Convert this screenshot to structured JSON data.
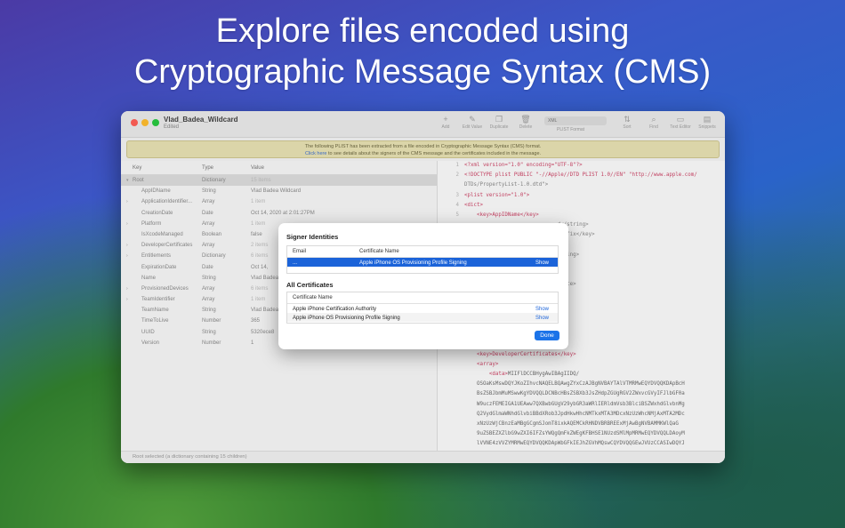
{
  "headline": {
    "line1": "Explore files encoded using",
    "line2": "Cryptographic Message Syntax (CMS)"
  },
  "window": {
    "title": "Vlad_Badea_Wildcard",
    "subtitle": "Edited",
    "format_value": "XML",
    "format_label": "PLIST Format",
    "toolbar": [
      {
        "label": "Add",
        "icon": "plus-icon"
      },
      {
        "label": "Edit Value",
        "icon": "pencil-icon"
      },
      {
        "label": "Duplicate",
        "icon": "duplicate-icon"
      },
      {
        "label": "Delete",
        "icon": "trash-icon"
      },
      {
        "label": "Sort",
        "icon": "sort-icon"
      },
      {
        "label": "Find",
        "icon": "search-icon"
      },
      {
        "label": "Text Editor",
        "icon": "sidebar-icon"
      },
      {
        "label": "Snippets",
        "icon": "snippets-icon"
      }
    ],
    "banner": {
      "line1": "The following PLIST has been extracted from a file encoded in Cryptographic Message Syntax (CMS) format.",
      "link": "Click here",
      "line2_rest": " to see details about the signers of the CMS message and the certificates included in the message."
    }
  },
  "outline": {
    "headers": {
      "key": "Key",
      "type": "Type",
      "value": "Value"
    },
    "rows": [
      {
        "key": "Root",
        "type": "Dictionary",
        "value": "15 items",
        "disclosure": "▾",
        "muted": true,
        "selected": true
      },
      {
        "key": "AppIDName",
        "type": "String",
        "value": "Vlad Badea Wildcard",
        "disclosure": "",
        "muted": false
      },
      {
        "key": "ApplicationIdentifier...",
        "type": "Array",
        "value": "1 item",
        "disclosure": "›",
        "muted": true
      },
      {
        "key": "CreationDate",
        "type": "Date",
        "value": "Oct 14, 2020 at 2:01:27PM",
        "disclosure": "",
        "muted": false
      },
      {
        "key": "Platform",
        "type": "Array",
        "value": "1 item",
        "disclosure": "›",
        "muted": true
      },
      {
        "key": "IsXcodeManaged",
        "type": "Boolean",
        "value": "false",
        "disclosure": "",
        "muted": false
      },
      {
        "key": "DeveloperCertificates",
        "type": "Array",
        "value": "2 items",
        "disclosure": "›",
        "muted": true
      },
      {
        "key": "Entitlements",
        "type": "Dictionary",
        "value": "6 items",
        "disclosure": "›",
        "muted": true
      },
      {
        "key": "ExpirationDate",
        "type": "Date",
        "value": "Oct 14,",
        "disclosure": "",
        "muted": false
      },
      {
        "key": "Name",
        "type": "String",
        "value": "Vlad Badea",
        "disclosure": "",
        "muted": false
      },
      {
        "key": "ProvisionedDevices",
        "type": "Array",
        "value": "6 items",
        "disclosure": "›",
        "muted": true
      },
      {
        "key": "TeamIdentifier",
        "type": "Array",
        "value": "1 item",
        "disclosure": "›",
        "muted": true
      },
      {
        "key": "TeamName",
        "type": "String",
        "value": "Vlad Badea",
        "disclosure": "",
        "muted": false
      },
      {
        "key": "TimeToLive",
        "type": "Number",
        "value": "365",
        "disclosure": "",
        "muted": false
      },
      {
        "key": "UUID",
        "type": "String",
        "value": "5320ece8",
        "disclosure": "",
        "muted": false
      },
      {
        "key": "Version",
        "type": "Number",
        "value": "1",
        "disclosure": "",
        "muted": false
      }
    ]
  },
  "code": {
    "lines": [
      {
        "n": "1",
        "parts": [
          [
            "tg",
            "<?xml version=\"1.0\" encoding=\"UTF-8\"?>"
          ]
        ]
      },
      {
        "n": "2",
        "parts": [
          [
            "tg",
            "<!DOCTYPE plist PUBLIC \"-//Apple//DTD PLIST 1.0//EN\" \"http://www.apple.com/"
          ]
        ]
      },
      {
        "n": "",
        "parts": [
          [
            "dt",
            "DTDs/PropertyList-1.0.dtd\">"
          ]
        ]
      },
      {
        "n": "3",
        "parts": [
          [
            "tg",
            "<plist version=\"1.0\">"
          ]
        ]
      },
      {
        "n": "4",
        "parts": [
          [
            "tg",
            "<dict>"
          ]
        ]
      },
      {
        "n": "5",
        "parts": [
          [
            "dt",
            "    "
          ],
          [
            "tg",
            "<key>AppIDName</key>"
          ]
        ]
      },
      {
        "n": "",
        "parts": [
          [
            "dt",
            "                              d</string>"
          ]
        ]
      },
      {
        "n": "",
        "parts": [
          [
            "dt",
            "                              Prefix</key>"
          ]
        ]
      },
      {
        "n": "",
        "parts": [
          [
            "dt",
            ""
          ]
        ]
      },
      {
        "n": "",
        "parts": [
          [
            "dt",
            "                              string>"
          ]
        ]
      },
      {
        "n": "",
        "parts": [
          [
            "dt",
            ""
          ]
        ]
      },
      {
        "n": "",
        "parts": [
          [
            "dt",
            ""
          ]
        ]
      },
      {
        "n": "",
        "parts": [
          [
            "dt",
            "                              /date>"
          ]
        ]
      },
      {
        "n": "",
        "parts": [
          [
            "dt",
            ""
          ]
        ]
      },
      {
        "n": "",
        "parts": [
          [
            "dt",
            ""
          ]
        ]
      },
      {
        "n": "",
        "parts": [
          [
            "dt",
            ""
          ]
        ]
      },
      {
        "n": "",
        "parts": [
          [
            "dt",
            ""
          ]
        ]
      },
      {
        "n": "",
        "parts": [
          [
            "dt",
            ""
          ]
        ]
      },
      {
        "n": "",
        "parts": [
          [
            "dt",
            ""
          ]
        ]
      },
      {
        "n": "",
        "parts": [
          [
            "dt",
            "    "
          ],
          [
            "tg",
            "<key>DeveloperCertificates</key>"
          ]
        ]
      },
      {
        "n": "",
        "parts": [
          [
            "dt",
            "    "
          ],
          [
            "tg",
            "<array>"
          ]
        ]
      },
      {
        "n": "",
        "parts": [
          [
            "dt",
            "        "
          ],
          [
            "tg",
            "<data>"
          ],
          [
            "b64",
            "MIIFlDCCBHygAwIBAgIIDQ/"
          ]
        ]
      },
      {
        "n": "",
        "parts": [
          [
            "b64",
            "    OSOaKsMswDQYJKoZIhvcNAQELBQAwgZYxCzAJBgNVBAYTAlVTMRMwEQYDVQQKDApBcH"
          ]
        ]
      },
      {
        "n": "",
        "parts": [
          [
            "b64",
            "    BsZSBJbmMuMSwwKgYDVQQLDCNBcHBsZSBXb3JsZHdpZGUgRGV2ZWxvcGVyIFJlbGF0a"
          ]
        ]
      },
      {
        "n": "",
        "parts": [
          [
            "b64",
            "    W9uczFEMEIGA1UEAww7QXBwbGUgV29ybGR3aWRlIERldmVsb3BlciBSZWxhdGlvbnMg"
          ]
        ]
      },
      {
        "n": "",
        "parts": [
          [
            "b64",
            "    Q2VydGlmaWNhdGlvbiBBdXRob3JpdHkwHhcNMTkxMTA3MDcxNzUzWhcNMjAxMTA2MDc"
          ]
        ]
      },
      {
        "n": "",
        "parts": [
          [
            "b64",
            "    xNzUzWjCBnzEaMBgGCgmSJomT8ixkAQEMCkRHNDVBRBREExMjAwBgNVBAMMKWlQaG"
          ]
        ]
      },
      {
        "n": "",
        "parts": [
          [
            "b64",
            "    9uZSBEZXZlbG9wZXI6IFZsYWQgQmFkZWEgKFBHSE1NUzdSMlMpMRMwEQYDVQQLDAoyM"
          ]
        ]
      },
      {
        "n": "",
        "parts": [
          [
            "b64",
            "    lVVNE4zVVZYMRMwEQYDVQQKDApWbGFkIEJhZGVhMQswCQYDVQQGEwJVUzCCASIwDQYJ"
          ]
        ]
      },
      {
        "n": "",
        "parts": [
          [
            "b64",
            "    KoZIhvcNAQEBBQADggEPADCCAQoCggEBALpyVSGWMIKZjfPWIWwnKrnrMwQ8J7PAun"
          ]
        ]
      }
    ]
  },
  "status": "Root selected (a dictionary containing 15 children)",
  "sheet": {
    "signers_title": "Signer Identities",
    "signers_headers": {
      "email": "Email",
      "name": "Certificate Name"
    },
    "signers": [
      {
        "email": "...",
        "name": "Apple iPhone OS Provisioning Profile Signing",
        "action": "Show"
      }
    ],
    "certs_title": "All Certificates",
    "certs_header": "Certificate Name",
    "certs": [
      {
        "name": "Apple iPhone Certification Authority",
        "action": "Show"
      },
      {
        "name": "Apple iPhone OS Provisioning Profile Signing",
        "action": "Show"
      }
    ],
    "done_label": "Done"
  },
  "colors": {
    "accent": "#1b63d9",
    "banner_bg": "#e7e1b3",
    "xml_tag": "#cc4466"
  }
}
